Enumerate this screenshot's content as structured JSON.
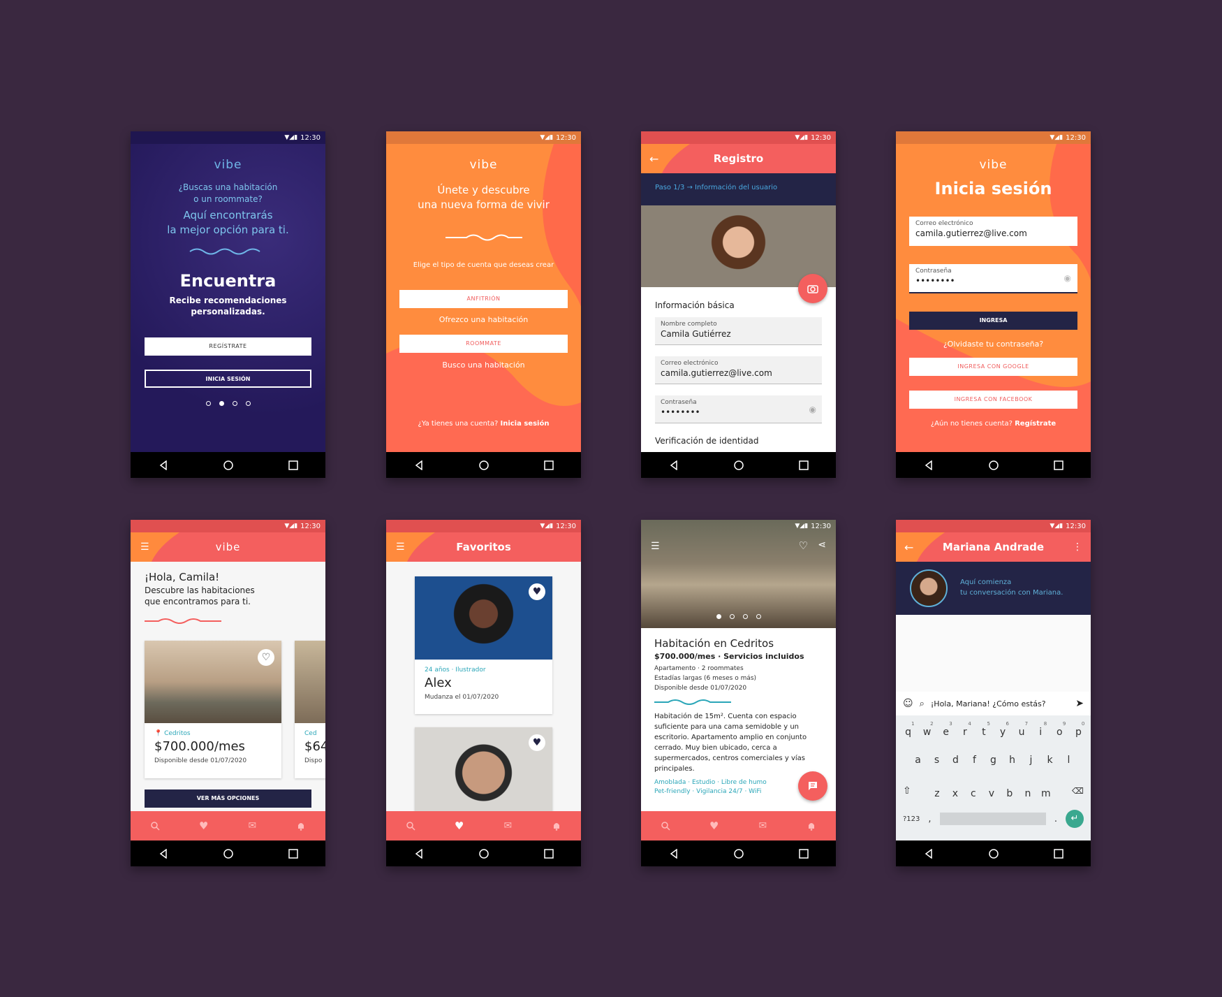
{
  "status_time": "12:30",
  "logo": "vibe",
  "s1": {
    "q1": "¿Buscas una habitación",
    "q2": "o un roommate?",
    "a1": "Aquí encontrarás",
    "a2": "la mejor opción para ti.",
    "title": "Encuentra",
    "sub1": "Recibe recomendaciones",
    "sub2": "personalizadas.",
    "btn_register": "REGÍSTRATE",
    "btn_login": "INICIA SESIÓN"
  },
  "s2": {
    "t1": "Únete y descubre",
    "t2": "una nueva forma de vivir",
    "choose": "Elige el tipo de cuenta que deseas crear",
    "btn_host": "ANFITRIÓN",
    "host_desc": "Ofrezco una habitación",
    "btn_roommate": "ROOMMATE",
    "roommate_desc": "Busco una habitación",
    "have_account": "¿Ya tienes una cuenta?",
    "login_link": "Inicia sesión"
  },
  "s3": {
    "title": "Registro",
    "step": "Paso 1/3 → Información del usuario",
    "section": "Información básica",
    "name_label": "Nombre completo",
    "name_value": "Camila Gutiérrez",
    "email_label": "Correo electrónico",
    "email_value": "camila.gutierrez@live.com",
    "pass_label": "Contraseña",
    "pass_value": "••••••••",
    "section2": "Verificación de identidad"
  },
  "s4": {
    "title": "Inicia sesión",
    "email_label": "Correo electrónico",
    "email_value": "camila.gutierrez@live.com",
    "pass_label": "Contraseña",
    "pass_value": "••••••••",
    "btn_login": "INGRESA",
    "forgot": "¿Olvidaste tu contraseña?",
    "btn_google": "INGRESA CON GOOGLE",
    "btn_facebook": "INGRESA CON FACEBOOK",
    "no_account": "¿Aún no tienes cuenta?",
    "register_link": "Regístrate"
  },
  "s5": {
    "greeting": "¡Hola, Camila!",
    "sub1": "Descubre las habitaciones",
    "sub2": "que encontramos para ti.",
    "location": "Cedritos",
    "price": "$700.000/mes",
    "available": "Disponible desde 01/07/2020",
    "location2": "Ced",
    "price2": "$64",
    "available2": "Dispo",
    "btn_more": "VER MÁS OPCIONES"
  },
  "s6": {
    "title": "Favoritos",
    "meta": "24 años · Ilustrador",
    "name": "Alex",
    "move": "Mudanza el 01/07/2020"
  },
  "s7": {
    "title": "Habitación en Cedritos",
    "price": "$700.000/mes · Servicios incluidos",
    "d1": "Apartamento · 2 roommates",
    "d2": "Estadías largas (6 meses o más)",
    "d3": "Disponible desde 01/07/2020",
    "desc": "Habitación de 15m². Cuenta con espacio suficiente para una cama semidoble y un escritorio. Apartamento amplio en conjunto cerrado. Muy bien ubicado, cerca a supermercados, centros comerciales y vías principales.",
    "tags1": "Amoblada · Estudio · Libre de humo",
    "tags2": "Pet-friendly · Vigilancia 24/7 · WiFi"
  },
  "s8": {
    "title": "Mariana Andrade",
    "intro1": "Aquí comienza",
    "intro2": "tu conversación con Mariana.",
    "message": "¡Hola, Mariana! ¿Cómo estás?",
    "row1": [
      "q",
      "w",
      "e",
      "r",
      "t",
      "y",
      "u",
      "i",
      "o",
      "p"
    ],
    "row1_nums": [
      "1",
      "2",
      "3",
      "4",
      "5",
      "6",
      "7",
      "8",
      "9",
      "0"
    ],
    "row2": [
      "a",
      "s",
      "d",
      "f",
      "g",
      "h",
      "j",
      "k",
      "l"
    ],
    "row3": [
      "z",
      "x",
      "c",
      "v",
      "b",
      "n",
      "m"
    ],
    "sym": "?123",
    "comma": ",",
    "period": "."
  },
  "colors": {
    "background": "#3a2840",
    "coral": "#f45f5e",
    "orange": "#ff8a3d",
    "navy": "#232446",
    "teal": "#2aa6b8"
  }
}
